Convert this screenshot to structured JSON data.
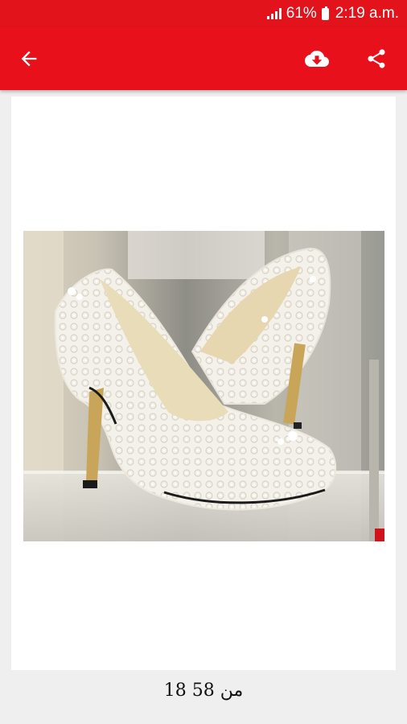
{
  "status_bar": {
    "battery": "61%",
    "time": "2:19 a.m."
  },
  "toolbar": {
    "back_icon": "arrow-left-icon",
    "download_icon": "cloud-download-icon",
    "share_icon": "share-icon"
  },
  "image": {
    "subject": "white lace bridal high-heel pumps on glass shelf"
  },
  "pager": {
    "label": "18 من 58"
  },
  "colors": {
    "primary": "#e8101a",
    "status_bar": "#e2131b",
    "background": "#efefef",
    "card": "#ffffff"
  }
}
